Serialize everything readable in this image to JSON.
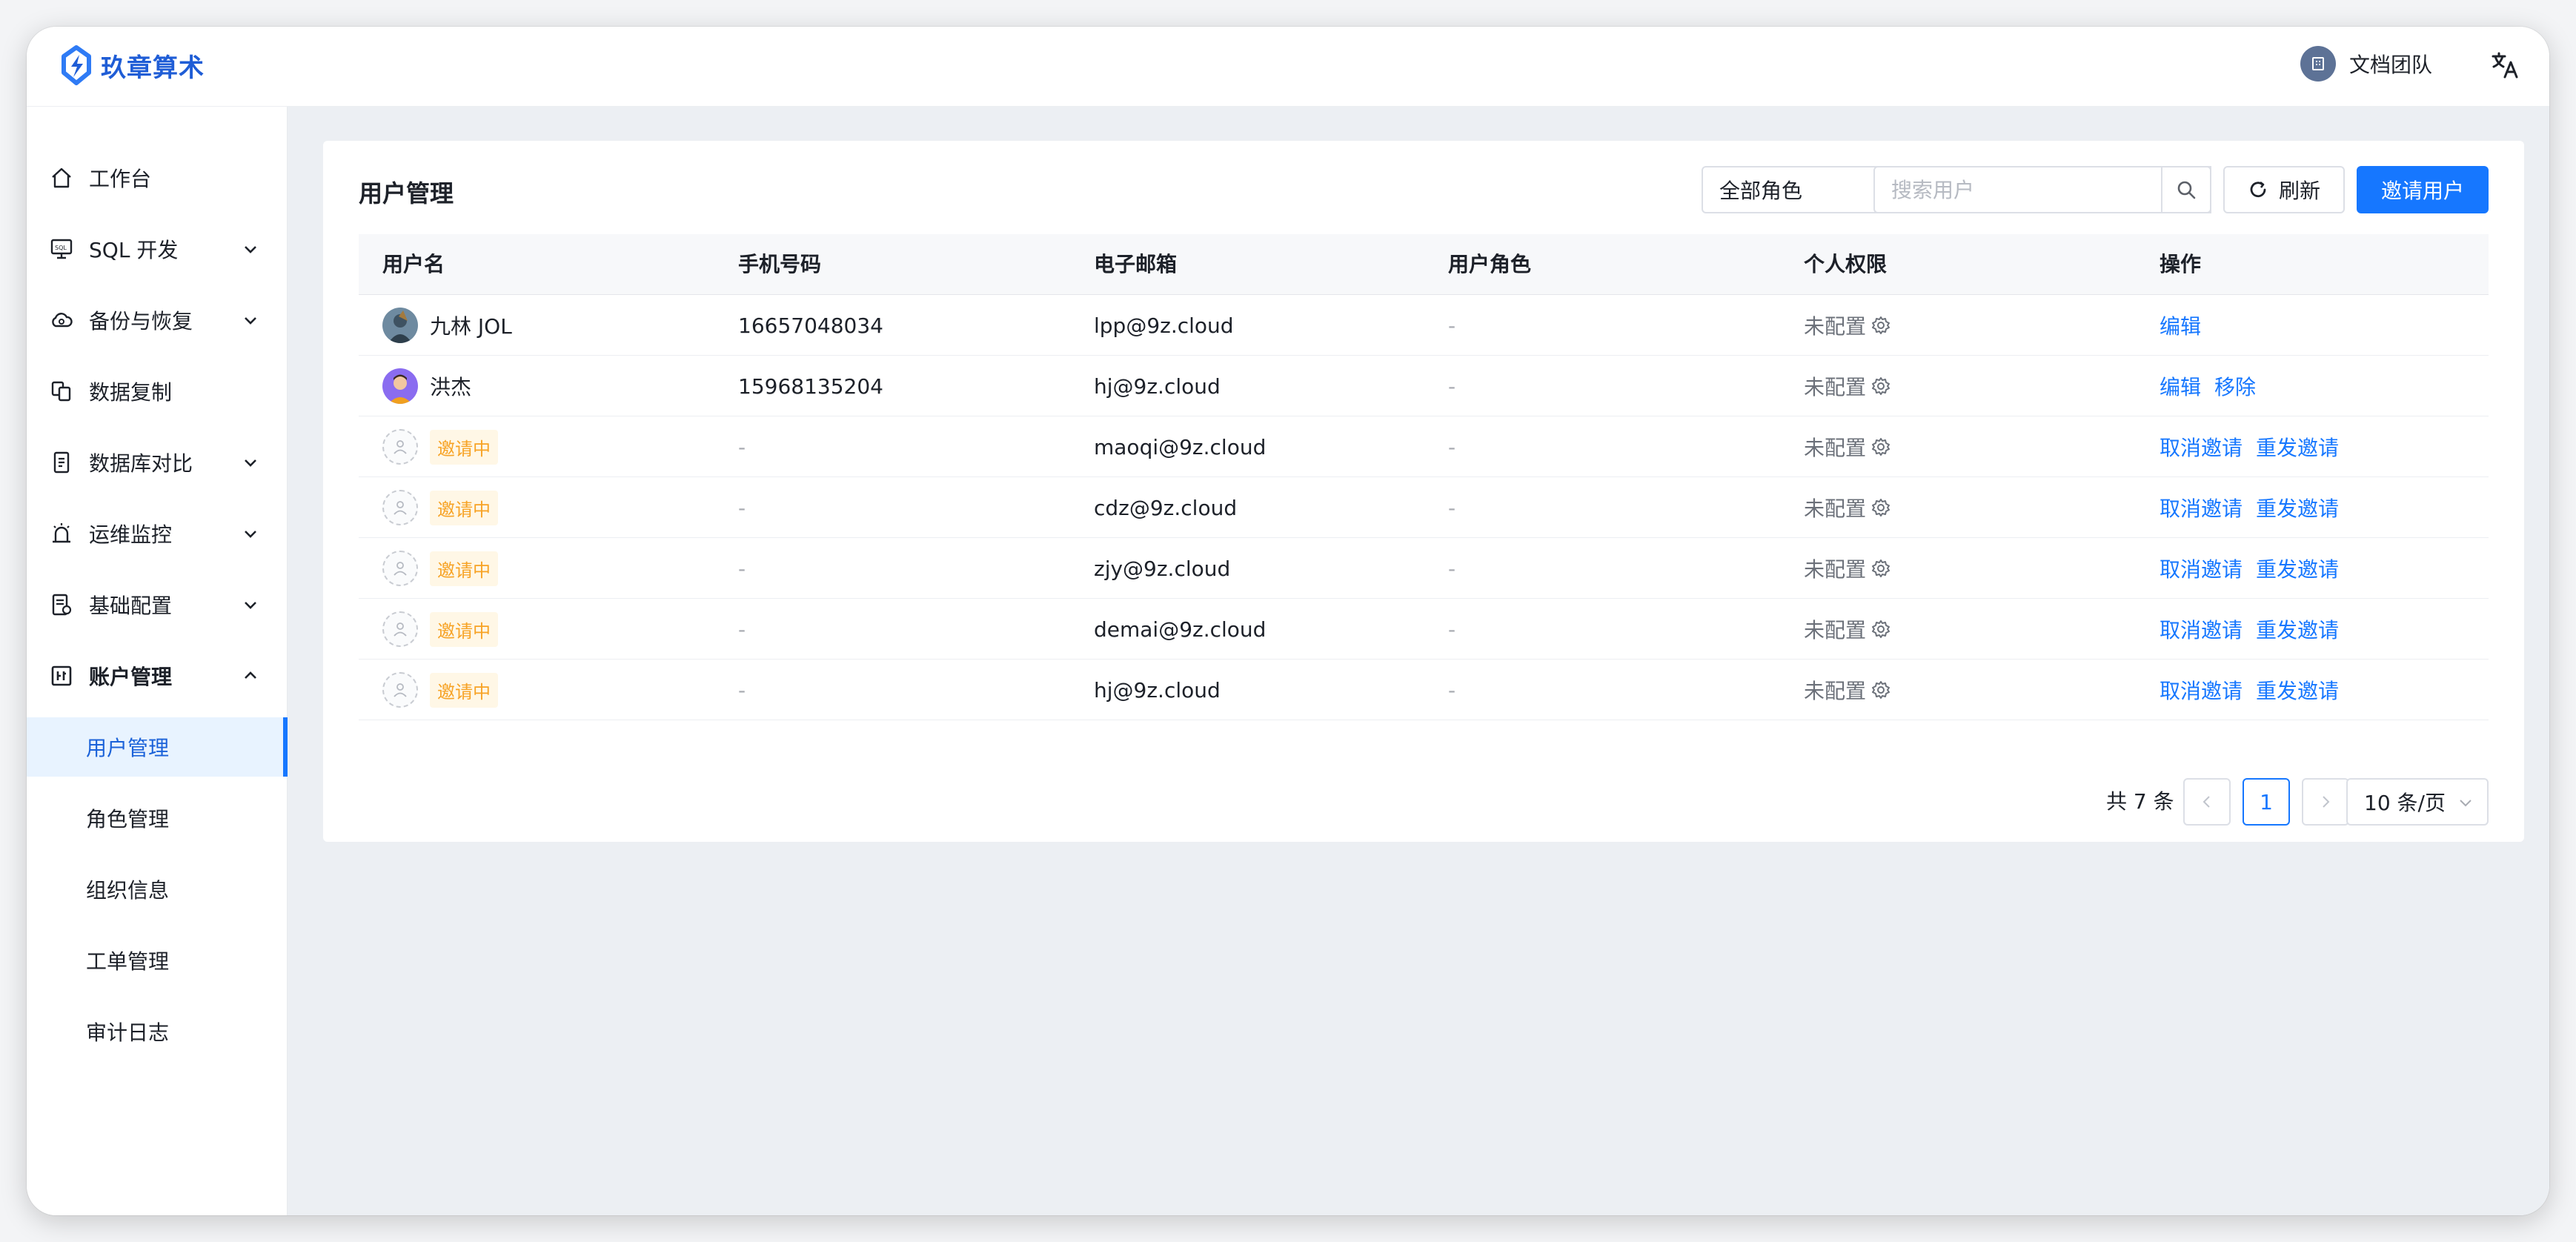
{
  "app": {
    "name": "玖章算术"
  },
  "header": {
    "team_name": "文档团队"
  },
  "colors": {
    "primary": "#1677ff",
    "pending": "#f7a325",
    "brand": "#1f5dd6"
  },
  "sidebar": {
    "items": [
      {
        "label": "工作台",
        "icon": "home-icon"
      },
      {
        "label": "SQL 开发",
        "icon": "sql-icon"
      },
      {
        "label": "备份与恢复",
        "icon": "cloud-icon"
      },
      {
        "label": "数据复制",
        "icon": "copy-icon"
      },
      {
        "label": "数据库对比",
        "icon": "compare-icon"
      },
      {
        "label": "运维监控",
        "icon": "alarm-icon"
      },
      {
        "label": "基础配置",
        "icon": "config-icon"
      },
      {
        "label": "账户管理",
        "icon": "account-icon"
      }
    ],
    "sub_items": [
      "用户管理",
      "角色管理",
      "组织信息",
      "工单管理",
      "审计日志"
    ]
  },
  "page": {
    "title": "用户管理",
    "role_filter": "全部角色",
    "search_placeholder": "搜索用户",
    "refresh_label": "刷新",
    "invite_label": "邀请用户"
  },
  "table": {
    "columns": [
      "用户名",
      "手机号码",
      "电子邮箱",
      "用户角色",
      "个人权限",
      "操作"
    ],
    "rows": [
      {
        "name": "九林 JOL",
        "phone": "16657048034",
        "email": "lpp@9z.cloud",
        "role": "-",
        "perm": "未配置",
        "actions": [
          "编辑"
        ]
      },
      {
        "name": "洪杰",
        "phone": "15968135204",
        "email": "hj@9z.cloud",
        "role": "-",
        "perm": "未配置",
        "actions": [
          "编辑",
          "移除"
        ]
      },
      {
        "name": "邀请中",
        "phone": "-",
        "email": "maoqi@9z.cloud",
        "role": "-",
        "perm": "未配置",
        "actions": [
          "取消邀请",
          "重发邀请"
        ]
      },
      {
        "name": "邀请中",
        "phone": "-",
        "email": "cdz@9z.cloud",
        "role": "-",
        "perm": "未配置",
        "actions": [
          "取消邀请",
          "重发邀请"
        ]
      },
      {
        "name": "邀请中",
        "phone": "-",
        "email": "zjy@9z.cloud",
        "role": "-",
        "perm": "未配置",
        "actions": [
          "取消邀请",
          "重发邀请"
        ]
      },
      {
        "name": "邀请中",
        "phone": "-",
        "email": "demai@9z.cloud",
        "role": "-",
        "perm": "未配置",
        "actions": [
          "取消邀请",
          "重发邀请"
        ]
      },
      {
        "name": "邀请中",
        "phone": "-",
        "email": "hj@9z.cloud",
        "role": "-",
        "perm": "未配置",
        "actions": [
          "取消邀请",
          "重发邀请"
        ]
      }
    ]
  },
  "pagination": {
    "total": "共 7 条",
    "current_page": "1",
    "page_size": "10 条/页"
  }
}
